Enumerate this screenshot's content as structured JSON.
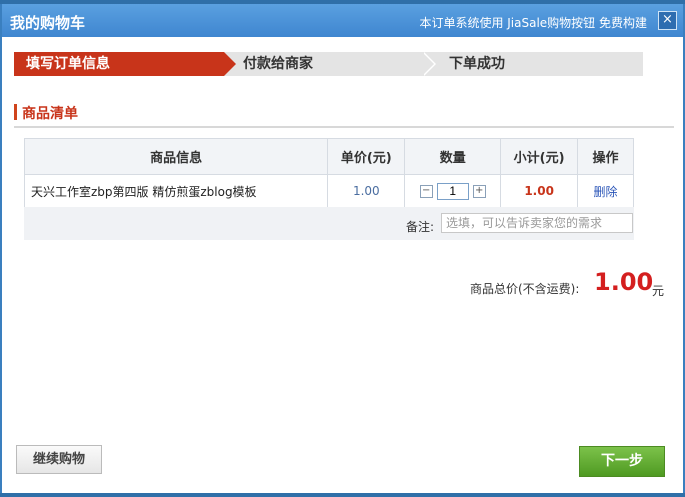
{
  "dialog": {
    "title": "我的购物车",
    "built_by": "本订单系统使用 JiaSale购物按钮 免费构建",
    "close_icon": "×"
  },
  "steps": [
    {
      "label": "填写订单信息",
      "active": true
    },
    {
      "label": "付款给商家",
      "active": false
    },
    {
      "label": "下单成功",
      "active": false
    }
  ],
  "section": {
    "title": "商品清单"
  },
  "table": {
    "headers": [
      "商品信息",
      "单价(元)",
      "数量",
      "小计(元)",
      "操作"
    ],
    "rows": [
      {
        "name": "天兴工作室zbp第四版 精仿煎蛋zblog模板",
        "price": "1.00",
        "qty": "1",
        "subtotal": "1.00",
        "op": "删除"
      }
    ]
  },
  "note": {
    "label": "备注:",
    "placeholder": "选填，可以告诉卖家您的需求"
  },
  "total": {
    "label": "商品总价(不含运费):",
    "value": "1.00",
    "unit": "元"
  },
  "buttons": {
    "continue": "继续购物",
    "next": "下一步"
  },
  "colors": {
    "accent": "#c8341a",
    "titlebar": "#4a90d8",
    "next": "#6bb33a",
    "price_total": "#d41f1f"
  }
}
